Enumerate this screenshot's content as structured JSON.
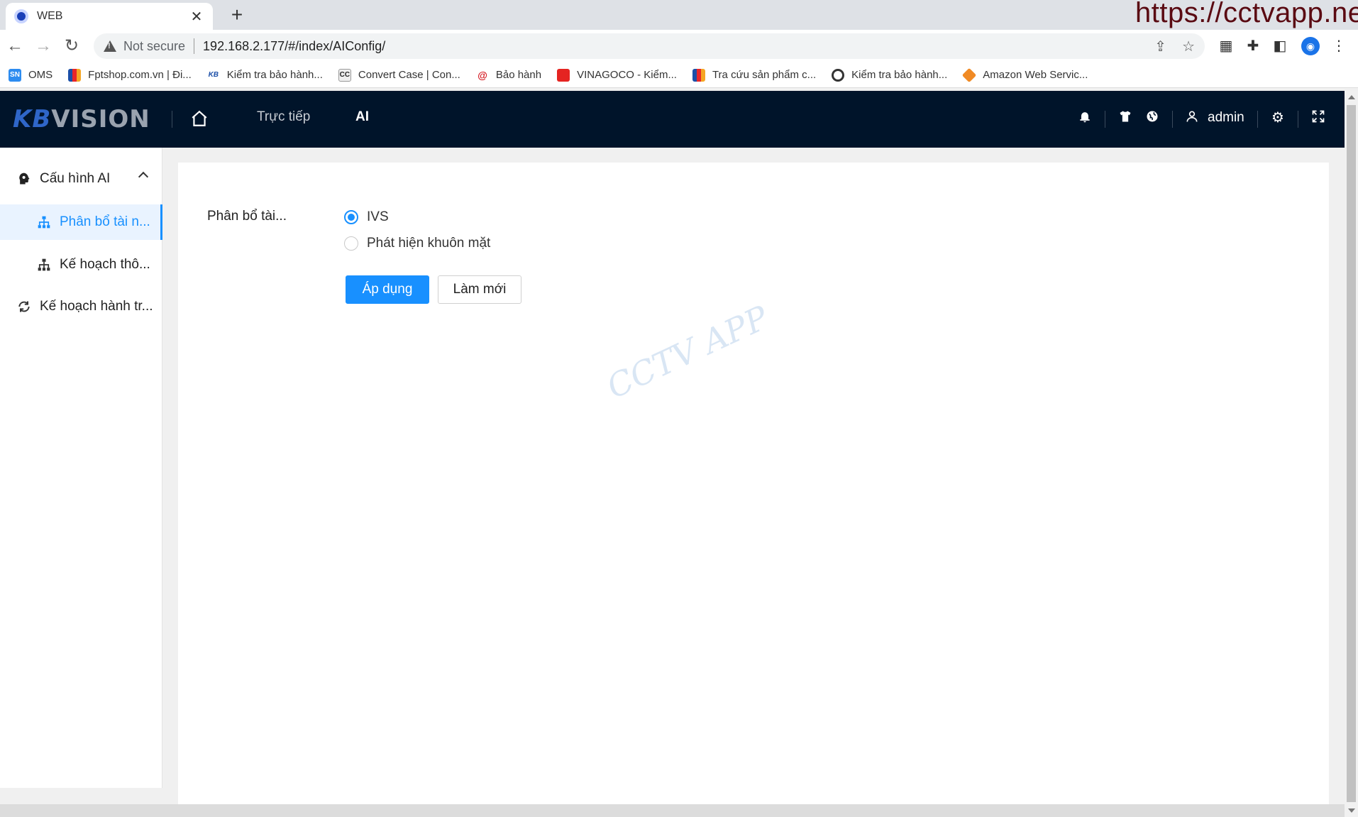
{
  "browser": {
    "tab_title": "WEB",
    "security_label": "Not secure",
    "url": "192.168.2.177/#/index/AIConfig/",
    "watermark": "https://cctvapp.net"
  },
  "bookmarks": [
    {
      "label": "OMS",
      "icon": "oms-icon",
      "color": "#2d8cf0"
    },
    {
      "label": "Fptshop.com.vn | Đi...",
      "icon": "fpt-icon",
      "color": "#e8262a"
    },
    {
      "label": "Kiểm tra bảo hành...",
      "icon": "kbvision-icon",
      "color": "#1b4fa8"
    },
    {
      "label": "Convert Case | Con...",
      "icon": "cc-icon",
      "color": "#333333"
    },
    {
      "label": "Bảo hành",
      "icon": "warranty-icon",
      "color": "#d4161e"
    },
    {
      "label": "VINAGOCO - Kiểm...",
      "icon": "vinagoco-icon",
      "color": "#e52421"
    },
    {
      "label": "Tra cứu sản phẩm c...",
      "icon": "fpt-icon",
      "color": "#f5a623"
    },
    {
      "label": "Kiểm tra bảo hành...",
      "icon": "eye-icon",
      "color": "#333333"
    },
    {
      "label": "Amazon Web Servic...",
      "icon": "aws-icon",
      "color": "#f08a24"
    }
  ],
  "header": {
    "logo_kb": "KB",
    "logo_vision": "VISION",
    "nav": {
      "live": "Trực tiếp",
      "ai": "AI"
    },
    "username": "admin"
  },
  "sidebar": {
    "group_ai": "Cấu hình AI",
    "item_resource": "Phân bổ tài n...",
    "item_plan": "Kế hoạch thô...",
    "group_schedule": "Kế hoạch hành tr..."
  },
  "content": {
    "field_label": "Phân bổ tài...",
    "options": {
      "ivs": "IVS",
      "face": "Phát hiện khuôn mặt"
    },
    "selected": "IVS",
    "apply": "Áp dụng",
    "refresh": "Làm mới",
    "watermark": "CCTV APP"
  },
  "colors": {
    "accent": "#1890ff",
    "header_bg": "#00142a"
  }
}
